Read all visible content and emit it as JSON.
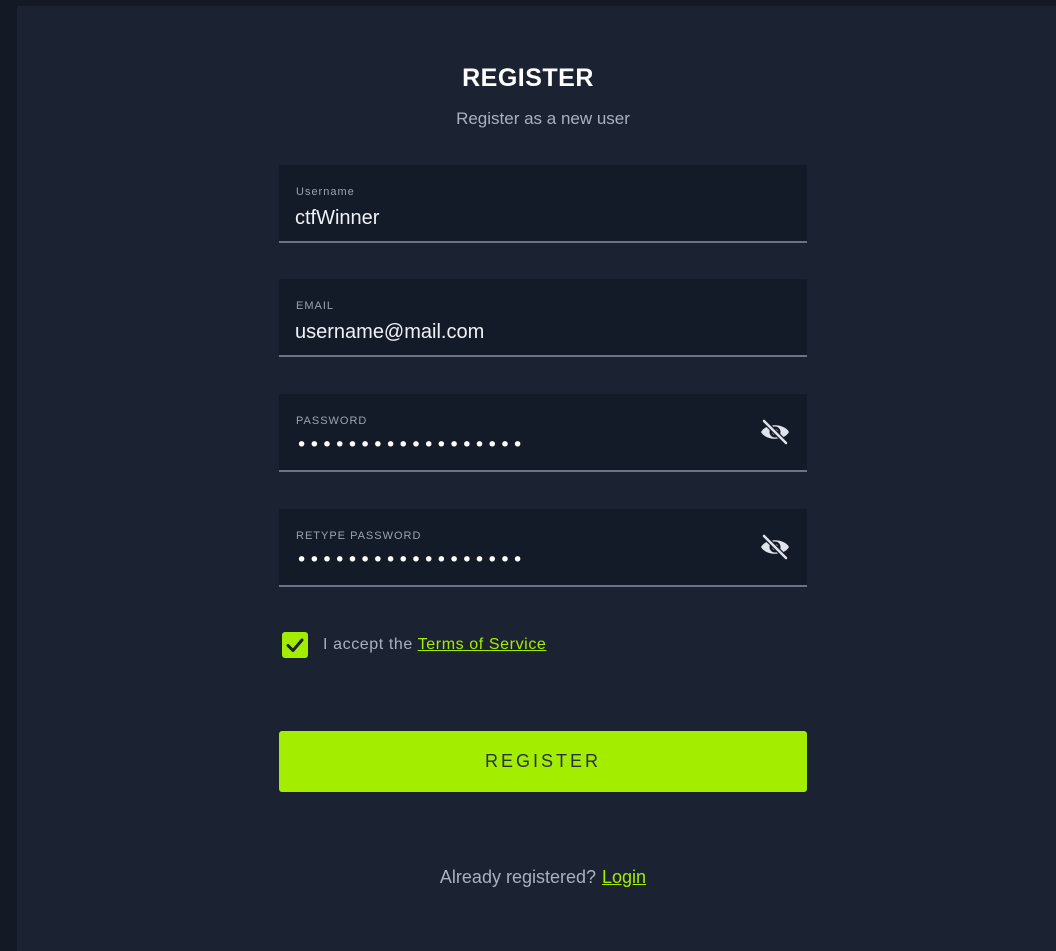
{
  "header": {
    "title": "REGISTER",
    "subtitle": "Register as a new user"
  },
  "form": {
    "username": {
      "label": "Username",
      "value": "ctfWinner"
    },
    "email": {
      "label": "EMAIL",
      "value": "username@mail.com"
    },
    "password": {
      "label": "PASSWORD",
      "masked_value": "••••••••••••••••••",
      "icon": "eye-slash-icon"
    },
    "retype_password": {
      "label": "RETYPE PASSWORD",
      "masked_value": "••••••••••••••••••",
      "icon": "eye-slash-icon"
    },
    "terms": {
      "checked": true,
      "prefix": "I accept the",
      "link_text": "Terms of Service"
    },
    "submit_label": "REGISTER"
  },
  "footer": {
    "prompt": "Already registered?",
    "login_label": "Login"
  },
  "colors": {
    "accent": "#a3ee00",
    "background": "#1b2231",
    "field_background": "#141b28"
  }
}
